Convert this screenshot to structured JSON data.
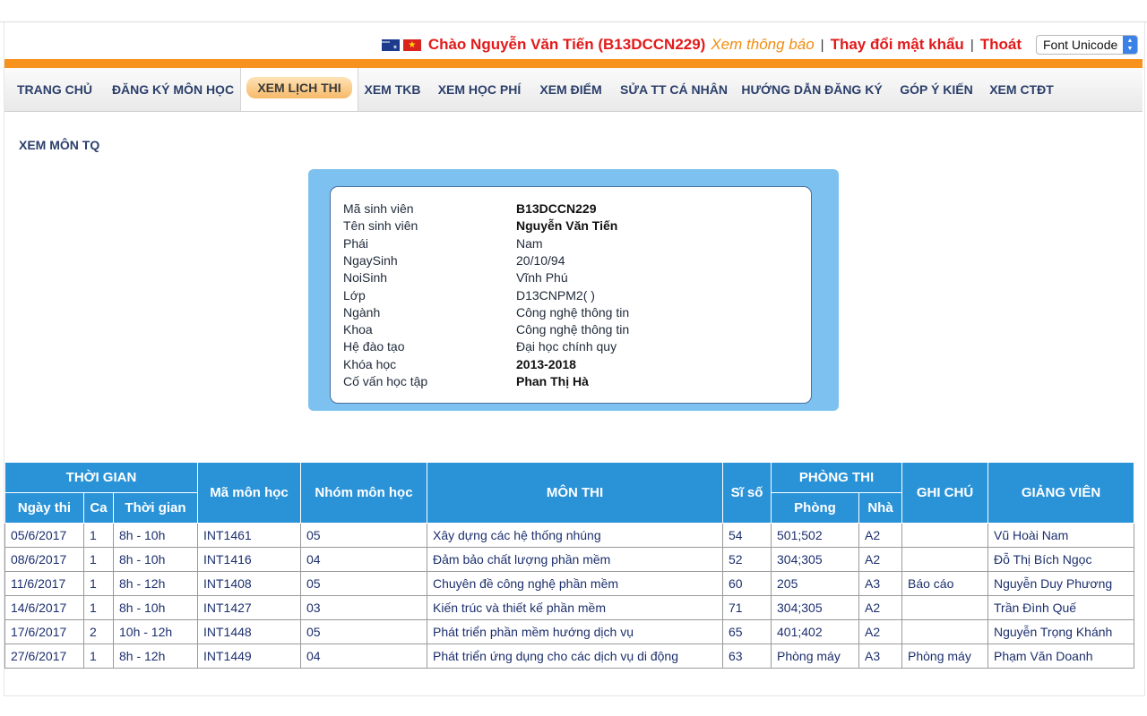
{
  "header": {
    "greeting": "Chào Nguyễn Văn Tiến (B13DCCN229)",
    "notice_link": "Xem thông báo",
    "separator": "|",
    "change_password": "Thay đổi mật khẩu",
    "logout": "Thoát",
    "font_select": "Font Unicode"
  },
  "nav": [
    {
      "label": "TRANG CHỦ"
    },
    {
      "label": "ĐĂNG KÝ MÔN HỌC"
    },
    {
      "label": "XEM LỊCH THI",
      "active": true
    },
    {
      "label": "XEM TKB"
    },
    {
      "label": "XEM HỌC PHÍ"
    },
    {
      "label": "XEM ĐIỂM"
    },
    {
      "label": "SỬA TT CÁ NHÂN"
    },
    {
      "label": "HƯỚNG DẪN ĐĂNG KÝ"
    },
    {
      "label": "GÓP Ý KIẾN"
    },
    {
      "label": "XEM CTĐT"
    }
  ],
  "page_title": "XEM MÔN TQ",
  "student_info": [
    {
      "label": "Mã sinh viên",
      "value": "B13DCCN229",
      "bold": true
    },
    {
      "label": "Tên sinh viên",
      "value": "Nguyễn Văn Tiến",
      "bold": true
    },
    {
      "label": "Phái",
      "value": "Nam"
    },
    {
      "label": "NgaySinh",
      "value": "20/10/94"
    },
    {
      "label": "NoiSinh",
      "value": "Vĩnh Phú"
    },
    {
      "label": "Lớp",
      "value": "D13CNPM2( )"
    },
    {
      "label": "Ngành",
      "value": "Công nghệ thông tin"
    },
    {
      "label": "Khoa",
      "value": "Công nghệ thông tin"
    },
    {
      "label": "Hệ đào tạo",
      "value": "Đại học chính quy"
    },
    {
      "label": "Khóa học",
      "value": "2013-2018",
      "bold": true
    },
    {
      "label": "Cố vấn học tập",
      "value": "Phan Thị Hà",
      "bold": true
    }
  ],
  "table": {
    "group_time": "THỜI GIAN",
    "col_date": "Ngày thi",
    "col_shift": "Ca",
    "col_time": "Thời gian",
    "col_code": "Mã môn học",
    "col_group": "Nhóm môn học",
    "col_subject": "MÔN THI",
    "col_count": "Sĩ số",
    "group_room": "PHÒNG THI",
    "col_room": "Phòng",
    "col_building": "Nhà",
    "col_note": "GHI CHÚ",
    "col_lecturer": "GIẢNG VIÊN",
    "rows": [
      [
        "05/6/2017",
        "1",
        "8h - 10h",
        "INT1461",
        "05",
        "Xây dựng các hệ thống nhúng",
        "54",
        "501;502",
        "A2",
        "",
        "Vũ Hoài Nam"
      ],
      [
        "08/6/2017",
        "1",
        "8h - 10h",
        "INT1416",
        "04",
        "Đảm bảo chất lượng phần mềm",
        "52",
        "304;305",
        "A2",
        "",
        "Đỗ Thị Bích Ngọc"
      ],
      [
        "11/6/2017",
        "1",
        "8h - 12h",
        "INT1408",
        "05",
        "Chuyên đề công nghệ phần mềm",
        "60",
        "205",
        "A3",
        "Báo cáo",
        "Nguyễn Duy Phương"
      ],
      [
        "14/6/2017",
        "1",
        "8h - 10h",
        "INT1427",
        "03",
        "Kiến trúc và thiết kế phần mềm",
        "71",
        "304;305",
        "A2",
        "",
        "Trần Đình Quế"
      ],
      [
        "17/6/2017",
        "2",
        "10h - 12h",
        "INT1448",
        "05",
        "Phát triển phần mềm hướng dịch vụ",
        "65",
        "401;402",
        "A2",
        "",
        "Nguyễn Trọng Khánh"
      ],
      [
        "27/6/2017",
        "1",
        "8h - 12h",
        "INT1449",
        "04",
        "Phát triển ứng dụng cho các dịch vụ di động",
        "63",
        "Phòng máy",
        "A3",
        "Phòng máy",
        "Phạm Văn Doanh"
      ]
    ]
  }
}
